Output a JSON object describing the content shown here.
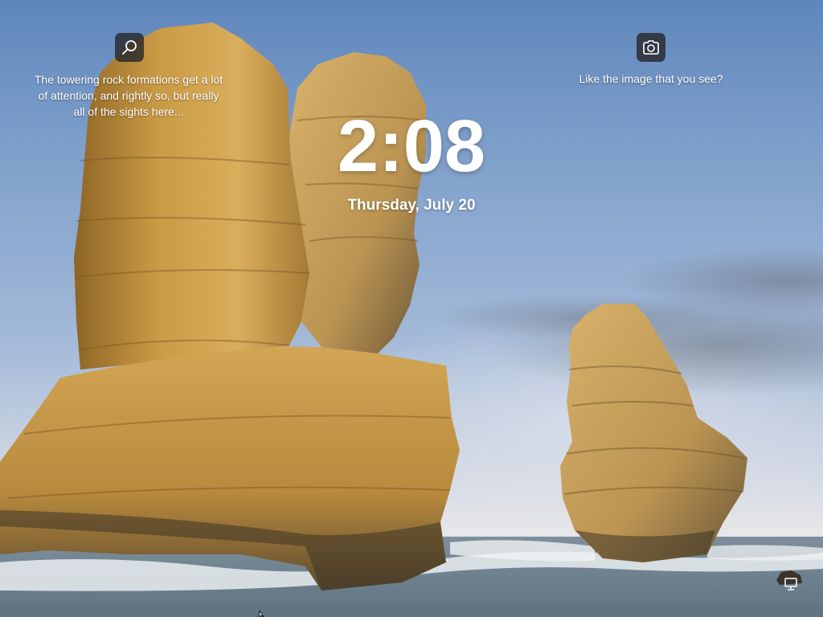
{
  "lock_screen": {
    "time": "2:08",
    "date": "Thursday, July 20"
  },
  "spotlight": {
    "info_text": "The towering rock formations get a lot of attention, and rightly so, but really all of the sights here...",
    "info_icon": "search-icon",
    "like_text": "Like the image that you see?",
    "like_icon": "camera-icon"
  },
  "system_tray": {
    "network_icon": "network-icon"
  },
  "colors": {
    "sky_top": "#5f86bb",
    "rock": "#c9973f",
    "sea": "#8a9aa3"
  }
}
